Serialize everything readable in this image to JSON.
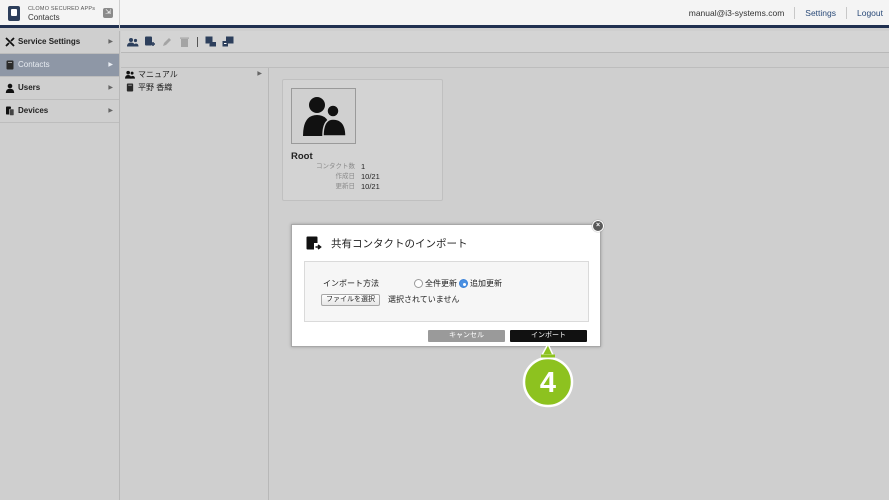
{
  "header": {
    "suite_name": "CLOMO SECURED APPs",
    "app_name": "Contacts",
    "user_email": "manual@i3-systems.com",
    "settings_label": "Settings",
    "logout_label": "Logout"
  },
  "sidebar": {
    "items": [
      {
        "label": "Service Settings",
        "icon": "tools-icon"
      },
      {
        "label": "Contacts",
        "icon": "address-book-icon",
        "active": true
      },
      {
        "label": "Users",
        "icon": "user-icon"
      },
      {
        "label": "Devices",
        "icon": "device-icon"
      }
    ]
  },
  "tree": {
    "items": [
      {
        "label": "マニュアル",
        "icon": "group-icon"
      },
      {
        "label": "平野 香織",
        "icon": "address-book-icon"
      }
    ]
  },
  "root_card": {
    "name": "Root",
    "fields": [
      {
        "key": "コンタクト数",
        "value": "1"
      },
      {
        "key": "作成日",
        "value": "10/21"
      },
      {
        "key": "更新日",
        "value": "10/21"
      }
    ]
  },
  "modal": {
    "title": "共有コンタクトのインポート",
    "method_label": "インポート方法",
    "options": [
      {
        "label": "全件更新",
        "selected": false
      },
      {
        "label": "追加更新",
        "selected": true
      }
    ],
    "file_button_label": "ファイルを選択",
    "file_status": "選択されていません",
    "cancel_label": "キャンセル",
    "import_label": "インポート"
  },
  "callout": {
    "step_number": "4",
    "color": "#8dc21f"
  },
  "colors": {
    "header_accent": "#203050",
    "sidebar_active": "#8e97a6",
    "radio_selected": "#4a90e2"
  }
}
